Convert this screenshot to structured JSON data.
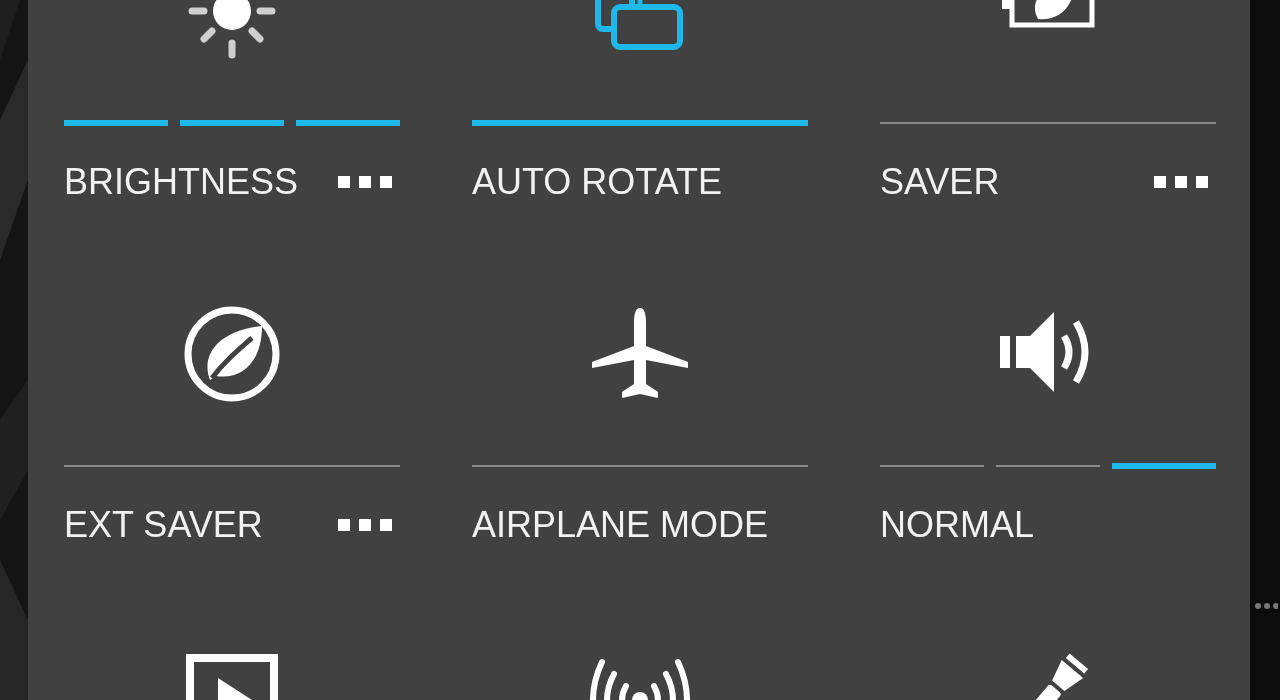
{
  "tiles": [
    {
      "label": "BRIGHTNESS",
      "menu": true,
      "active": false,
      "segments": [
        {
          "on": true
        },
        {
          "on": true
        },
        {
          "on": true
        }
      ]
    },
    {
      "label": "AUTO ROTATE",
      "menu": false,
      "active": true,
      "segments": [
        {
          "on": true
        }
      ]
    },
    {
      "label": "SAVER",
      "menu": true,
      "active": false,
      "segments": [
        {
          "on": false
        }
      ]
    },
    {
      "label": "EXT SAVER",
      "menu": true,
      "active": false,
      "segments": [
        {
          "on": false
        }
      ]
    },
    {
      "label": "AIRPLANE MODE",
      "menu": false,
      "active": false,
      "segments": [
        {
          "on": false
        }
      ]
    },
    {
      "label": "NORMAL",
      "menu": false,
      "active": false,
      "segments": [
        {
          "on": false
        },
        {
          "on": false
        },
        {
          "on": true
        }
      ]
    },
    {
      "active": false
    },
    {
      "active": false
    },
    {
      "active": false
    }
  ]
}
